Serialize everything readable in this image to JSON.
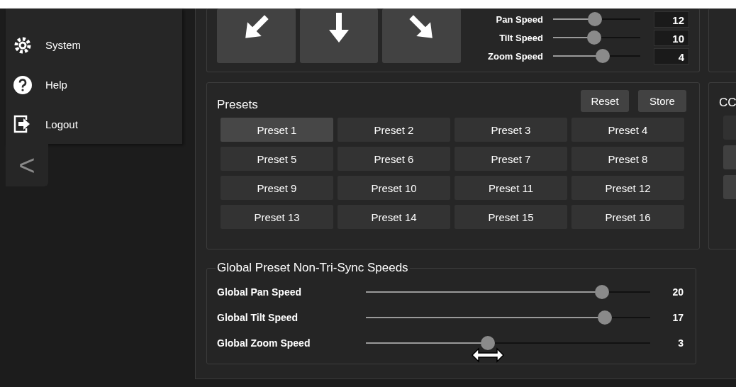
{
  "sidebar": {
    "items": [
      {
        "label": "System"
      },
      {
        "label": "Help"
      },
      {
        "label": "Logout"
      }
    ],
    "collapse": "<"
  },
  "movement": {
    "speeds": [
      {
        "label": "Pan Speed",
        "level": 0.48,
        "value": "12"
      },
      {
        "label": "Tilt Speed",
        "level": 0.47,
        "value": "10"
      },
      {
        "label": "Zoom Speed",
        "level": 0.57,
        "value": "4"
      }
    ]
  },
  "presets": {
    "title": "Presets",
    "actions": [
      "Reset",
      "Store"
    ],
    "items": [
      {
        "label": "Preset 1",
        "selected": true
      },
      {
        "label": "Preset 2",
        "selected": false
      },
      {
        "label": "Preset 3",
        "selected": false
      },
      {
        "label": "Preset 4",
        "selected": false
      },
      {
        "label": "Preset 5",
        "selected": false
      },
      {
        "label": "Preset 6",
        "selected": false
      },
      {
        "label": "Preset 7",
        "selected": false
      },
      {
        "label": "Preset 8",
        "selected": false
      },
      {
        "label": "Preset 9",
        "selected": false
      },
      {
        "label": "Preset 10",
        "selected": false
      },
      {
        "label": "Preset 11",
        "selected": false
      },
      {
        "label": "Preset 12",
        "selected": false
      },
      {
        "label": "Preset 13",
        "selected": false
      },
      {
        "label": "Preset 14",
        "selected": false
      },
      {
        "label": "Preset 15",
        "selected": false
      },
      {
        "label": "Preset 16",
        "selected": false
      }
    ]
  },
  "ccu": {
    "title": "CC"
  },
  "global_speeds": {
    "title": "Global Preset Non-Tri-Sync Speeds",
    "rows": [
      {
        "label": "Global Pan Speed",
        "level": 0.83,
        "value": "20",
        "cursor": false
      },
      {
        "label": "Global Tilt Speed",
        "level": 0.84,
        "value": "17",
        "cursor": false
      },
      {
        "label": "Global Zoom Speed",
        "level": 0.43,
        "value": "3",
        "cursor": true
      }
    ]
  }
}
